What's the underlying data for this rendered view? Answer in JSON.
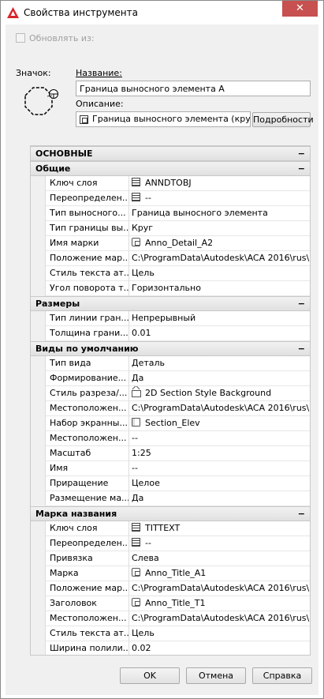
{
  "window": {
    "title": "Свойства инструмента",
    "close_glyph": "✕"
  },
  "update_from": {
    "label": "Обновлять из:",
    "checked": false
  },
  "icon_label": "Значок:",
  "name": {
    "label": "Название:",
    "value": "Граница выносного элемента A"
  },
  "description": {
    "label": "Описание:",
    "value": "Граница выносного элемента (кру",
    "details_label": "Подробности"
  },
  "sections": [
    {
      "title": "ОСНОВНЫЕ",
      "toggle": "−",
      "top_level": true,
      "rows": []
    },
    {
      "title": "Общие",
      "toggle": "−",
      "rows": [
        {
          "name": "Ключ слоя",
          "value": "ANNDTOBJ",
          "icon": "table-icon"
        },
        {
          "name": "Переопределен...",
          "value": "--",
          "icon": "table-icon"
        },
        {
          "name": "Тип выносного...",
          "value": "Граница выносного элемента",
          "icon": ""
        },
        {
          "name": "Тип границы вы...",
          "value": "Круг",
          "icon": ""
        },
        {
          "name": "Имя марки",
          "value": "Anno_Detail_A2",
          "icon": "anno-block-icon"
        },
        {
          "name": "Положение мар...",
          "value": "C:\\ProgramData\\Autodesk\\ACA 2016\\rus\\St...",
          "icon": ""
        },
        {
          "name": "Стиль текста ат...",
          "value": "Цель",
          "icon": ""
        },
        {
          "name": "Угол поворота т...",
          "value": "Горизонтально",
          "icon": ""
        }
      ]
    },
    {
      "title": "Размеры",
      "toggle": "−",
      "rows": [
        {
          "name": "Тип линии гран...",
          "value": "Непрерывный",
          "icon": ""
        },
        {
          "name": "Толщина грани...",
          "value": "0.01",
          "icon": ""
        }
      ]
    },
    {
      "title": "Виды по умолчанию",
      "toggle": "−",
      "rows": [
        {
          "name": "Тип вида",
          "value": "Деталь",
          "icon": ""
        },
        {
          "name": "Формирование...",
          "value": "Да",
          "icon": ""
        },
        {
          "name": "Стиль разреза/...",
          "value": "2D Section Style Background",
          "icon": "section-style-icon"
        },
        {
          "name": "Местоположен...",
          "value": "C:\\ProgramData\\Autodesk\\ACA 2016\\rus\\St...",
          "icon": ""
        },
        {
          "name": "Набор экранны...",
          "value": "Section_Elev",
          "icon": "sheet-set-icon"
        },
        {
          "name": "Местоположен...",
          "value": "--",
          "icon": ""
        },
        {
          "name": "Масштаб",
          "value": "1:25",
          "icon": ""
        },
        {
          "name": "Имя",
          "value": "--",
          "icon": ""
        },
        {
          "name": "Приращение",
          "value": "Целое",
          "icon": ""
        },
        {
          "name": "Размещение ма...",
          "value": "Да",
          "icon": ""
        }
      ]
    },
    {
      "title": "Марка названия",
      "toggle": "−",
      "rows": [
        {
          "name": "Ключ слоя",
          "value": "TITTEXT",
          "icon": "table-icon"
        },
        {
          "name": "Переопределен...",
          "value": "--",
          "icon": "table-icon"
        },
        {
          "name": "Привязка",
          "value": "Слева",
          "icon": ""
        },
        {
          "name": "Марка",
          "value": "Anno_Title_A1",
          "icon": "anno-block-icon"
        },
        {
          "name": "Положение мар...",
          "value": "C:\\ProgramData\\Autodesk\\ACA 2016\\rus\\St...",
          "icon": ""
        },
        {
          "name": "Заголовок",
          "value": "Anno_Title_T1",
          "icon": "anno-block-icon"
        },
        {
          "name": "Местоположен...",
          "value": "C:\\ProgramData\\Autodesk\\ACA 2016\\rus\\St...",
          "icon": ""
        },
        {
          "name": "Стиль текста ат...",
          "value": "Цель",
          "icon": ""
        },
        {
          "name": "Ширина полили...",
          "value": "0.02",
          "icon": ""
        }
      ]
    }
  ],
  "buttons": {
    "ok": "OK",
    "cancel": "Отмена",
    "help": "Справка"
  }
}
